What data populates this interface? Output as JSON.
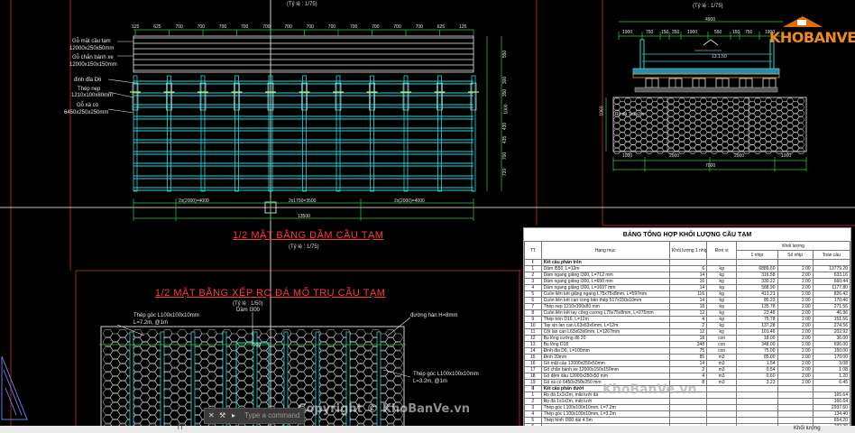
{
  "scale_top": "(Tỷ lệ : 1/75)",
  "scale_right": "(Tỷ lệ : 1/75)",
  "plan": {
    "title": "1/2 MẶT BẰNG DẦM CẦU TẠM",
    "scale": "(Tỷ lệ : 1/75)",
    "top_dims": [
      "125",
      "625",
      "700",
      "700",
      "700",
      "700",
      "700",
      "700",
      "700",
      "700",
      "700",
      "700",
      "700",
      "700",
      "625",
      "125"
    ],
    "bottom_dims": [
      "2x(2000)=4000",
      "2x1750=3500",
      "2x(2000)=4000"
    ],
    "total_dim": "13500",
    "right_dims": [
      "550",
      "300",
      "350",
      "1000",
      "430",
      "435",
      "700",
      "720"
    ],
    "labels": [
      "Gỗ mặt cầu tạm",
      "12000x250x50mm",
      "Gỗ chắn bánh xe",
      "12000x150x150mm",
      "đinh đỉa D6",
      "Thép nẹp",
      "1210x100x80mm",
      "Gỗ xà cò",
      "6450x250x250mm"
    ]
  },
  "section": {
    "top_dim": "4900",
    "dims_row": [
      "1900",
      "750",
      "150",
      "350",
      "1900",
      "550",
      "150",
      "750",
      "1900"
    ],
    "bottom_dims": [
      "1000",
      "2000",
      "2000",
      "1000"
    ],
    "total_dim": "7000",
    "left_dim": "1060",
    "labels": [
      "13.1.50",
      "Rọ đá 1x1x2m"
    ]
  },
  "gabion": {
    "title": "1/2 MẶT BẰNG XẾP RỌ ĐÁ MỐ TRỤ CẦU TẠM",
    "scale": "(Tỷ lệ : 1/50)",
    "labels": [
      "Thép góc L100x100x10mm",
      "L=7.2m, @1m",
      "Dầm I300",
      "đường hàn H=8mm",
      "Thép góc L100x100x10mm",
      "L=3.2m, @1m",
      "7500"
    ]
  },
  "table": {
    "title": "BẢNG TỔNG HỢP KHỐI LƯỢNG CẦU TẠM",
    "headers": [
      "TT",
      "Hạng mục",
      "Khối lượng 1 nhịp",
      "Đơn vị",
      "1 nhịp",
      "Số nhịp",
      "Toàn cầu"
    ],
    "group_header": "Khối lượng",
    "rows": [
      [
        "I",
        "Kết cấu phần trên",
        "",
        "",
        "",
        "",
        ""
      ],
      [
        "1",
        "Dầm I550, L=12m",
        "6",
        "kg",
        "6889.60",
        "2.00",
        "13779.20"
      ],
      [
        "2",
        "Dầm ngang giằng I300, L=712 mm",
        "14",
        "kg",
        "316.58",
        "2.00",
        "633.16"
      ],
      [
        "3",
        "Dầm ngang giằng I300, L=650 mm",
        "16",
        "kg",
        "330.22",
        "2.00",
        "660.44"
      ],
      [
        "4",
        "Dầm ngang giằng I300, L=1697 mm",
        "14",
        "kg",
        "588.90",
        "2.00",
        "1177.80"
      ],
      [
        "5",
        "Cuốn liên kết giằng ngang L75x75x8mm, L=597mm",
        "116",
        "kg",
        "413.21",
        "2.00",
        "826.42"
      ],
      [
        "6",
        "Cuốn liên kết cạn cong bản thép 517x150x10mm",
        "14",
        "kg",
        "85.23",
        "2.00",
        "170.46"
      ],
      [
        "7",
        "Thép nẹp 1210x100x80 mm",
        "18",
        "kg",
        "135.78",
        "2.00",
        "271.56"
      ],
      [
        "8",
        "Cuốn liên kết tay công cương L75x75x8mm, L=275mm",
        "12",
        "kg",
        "23.48",
        "2.00",
        "46.96"
      ],
      [
        "9",
        "Thép tròn D16, L=12m",
        "4",
        "kg",
        "75.78",
        "2.00",
        "151.56"
      ],
      [
        "10",
        "Tay vịn lan can L63x63x6mm, L=12m",
        "2",
        "kg",
        "137.28",
        "2.00",
        "274.56"
      ],
      [
        "11",
        "Cột lan can L63x63x6mm, L=1267mm",
        "12",
        "kg",
        "101.46",
        "2.00",
        "202.92"
      ],
      [
        "12",
        "Bu lông cường độ 20",
        "18",
        "con",
        "18.00",
        "2.00",
        "36.00"
      ],
      [
        "13",
        "Bu lông D18",
        "348",
        "con",
        "348.00",
        "2.00",
        "696.00"
      ],
      [
        "14",
        "Đinh đỉa D6, L=100mm",
        "75",
        "con",
        "75.00",
        "2.00",
        "150.00"
      ],
      [
        "15",
        "Đinh 20mm",
        "85",
        "m3",
        "85.00",
        "2.00",
        "170.00"
      ],
      [
        "16",
        "Gỗ mặt cầu 12000x250x50mm",
        "14",
        "m3",
        "1.54",
        "2.00",
        "3.08"
      ],
      [
        "17",
        "Gỗ chắn bánh xe 12000x150x150mm",
        "2",
        "m3",
        "0.54",
        "2.00",
        "1.08"
      ],
      [
        "18",
        "Gỗ đệm dầu 12000x250x50 mm",
        "4",
        "m3",
        "0.60",
        "2.00",
        "1.20"
      ],
      [
        "19",
        "Gỗ xà cò 6450x250x250 mm",
        "8",
        "m3",
        "3.23",
        "2.00",
        "6.45"
      ],
      [
        "II",
        "Kết cấu phần dưới",
        "",
        "",
        "",
        "",
        ""
      ],
      [
        "1",
        "Rọ đá 1x1x2m, mắt lưới đá",
        "",
        "",
        "",
        "",
        "165.64"
      ],
      [
        "2",
        "Rọ đá 1x1x2m, mắt lưới",
        "",
        "",
        "",
        "",
        "166.64"
      ],
      [
        "3",
        "Thép góc L100x100x10mm, L=7.2m",
        "",
        "",
        "",
        "",
        "2937.60"
      ],
      [
        "4",
        "Thép góc L100x100x10mm, L=3.2m",
        "",
        "",
        "",
        "",
        "134.40"
      ],
      [
        "5",
        "Thép hình I300 dài 4.5m",
        "",
        "",
        "",
        "",
        "654.20"
      ],
      [
        "6",
        "",
        "",
        "",
        "",
        "",
        "232.20"
      ]
    ]
  },
  "cmdbar": {
    "text": "Type a command"
  },
  "bottombar": {
    "tt": "TT",
    "right": "Khối lượng"
  },
  "logo": {
    "text": "KHOBANVE"
  },
  "watermarks": [
    "Copyright © KhoBanVe.vn",
    "KhoBanVe.vn"
  ]
}
